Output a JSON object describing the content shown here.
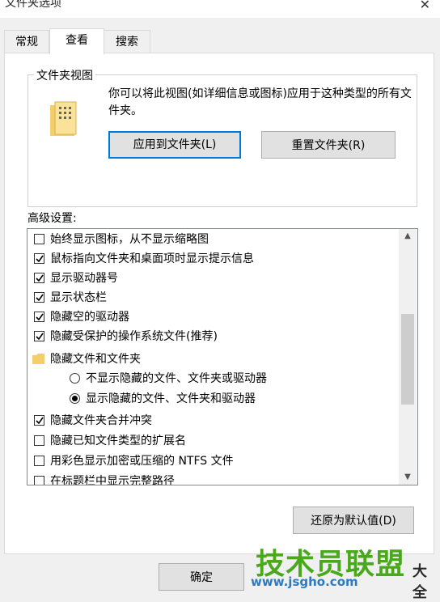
{
  "window": {
    "title": "文件夹选项",
    "close_glyph": "✕"
  },
  "tabs": [
    {
      "label": "常规"
    },
    {
      "label": "查看"
    },
    {
      "label": "搜索"
    }
  ],
  "folder_views": {
    "group_label": "文件夹视图",
    "description": "你可以将此视图(如详细信息或图标)应用于这种类型的所有文件夹。",
    "apply_button": "应用到文件夹(L)",
    "reset_button": "重置文件夹(R)"
  },
  "advanced": {
    "label": "高级设置:",
    "items": [
      {
        "type": "checkbox",
        "label": "始终显示图标，从不显示缩略图",
        "checked": false
      },
      {
        "type": "checkbox",
        "label": "鼠标指向文件夹和桌面项时显示提示信息",
        "checked": true
      },
      {
        "type": "checkbox",
        "label": "显示驱动器号",
        "checked": true
      },
      {
        "type": "checkbox",
        "label": "显示状态栏",
        "checked": true
      },
      {
        "type": "checkbox",
        "label": "隐藏空的驱动器",
        "checked": true
      },
      {
        "type": "checkbox",
        "label": "隐藏受保护的操作系统文件(推荐)",
        "checked": true
      },
      {
        "type": "folder",
        "label": "隐藏文件和文件夹"
      },
      {
        "type": "radio",
        "label": "不显示隐藏的文件、文件夹或驱动器",
        "selected": false
      },
      {
        "type": "radio",
        "label": "显示隐藏的文件、文件夹和驱动器",
        "selected": true
      },
      {
        "type": "checkbox",
        "label": "隐藏文件夹合并冲突",
        "checked": true
      },
      {
        "type": "checkbox",
        "label": "隐藏已知文件类型的扩展名",
        "checked": false
      },
      {
        "type": "checkbox",
        "label": "用彩色显示加密或压缩的 NTFS 文件",
        "checked": false
      },
      {
        "type": "checkbox",
        "label": "在标题栏中显示完整路径",
        "checked": false
      }
    ],
    "restore_button": "还原为默认值(D)"
  },
  "footer": {
    "ok_button": "确定"
  },
  "watermark": {
    "text": "技术员联盟",
    "suffix": "大全",
    "url": "www.jsgho.com"
  },
  "colors": {
    "accent": "#0078d7",
    "watermark": "#4aa81d"
  }
}
